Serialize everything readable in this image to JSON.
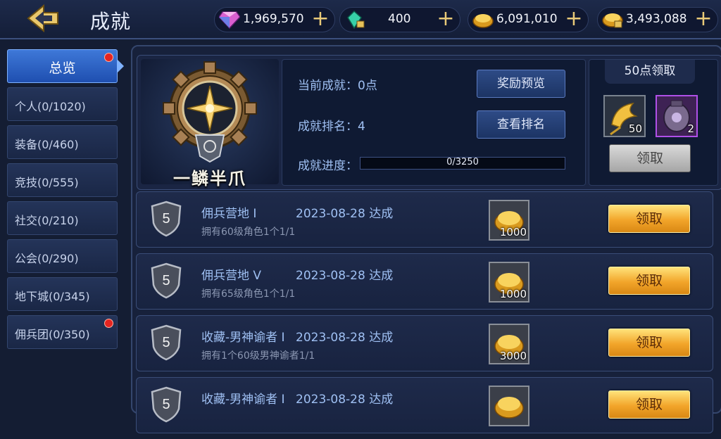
{
  "header": {
    "title": "成就",
    "currencies": [
      {
        "icon": "diamond-icon",
        "value": "1,969,570"
      },
      {
        "icon": "bound-crystal-icon",
        "value": "400"
      },
      {
        "icon": "gold-icon",
        "value": "6,091,010"
      },
      {
        "icon": "bound-gold-icon",
        "value": "3,493,088"
      }
    ]
  },
  "sidebar": {
    "tabs": [
      {
        "label": "总览",
        "active": true,
        "badge": true
      },
      {
        "label": "个人(0/1020)"
      },
      {
        "label": "装备(0/460)"
      },
      {
        "label": "竞技(0/555)"
      },
      {
        "label": "社交(0/210)"
      },
      {
        "label": "公会(0/290)"
      },
      {
        "label": "地下城(0/345)"
      },
      {
        "label": "佣兵团(0/350)",
        "badge": true
      }
    ]
  },
  "summary": {
    "title_name": "一鳞半爪",
    "current_label": "当前成就：0点",
    "rank_label": "成就排名：4",
    "progress_label": "成就进度：",
    "progress_text": "0/3250",
    "progress_value": 0,
    "preview_button": "奖励预览",
    "rank_button": "查看排名"
  },
  "milestone": {
    "title": "50点领取",
    "items": [
      {
        "icon": "ginkgo-leaf-icon",
        "count": "50"
      },
      {
        "icon": "purple-urn-icon",
        "count": "2"
      }
    ],
    "button": "领取"
  },
  "achievements": [
    {
      "level": "5",
      "name": "佣兵营地 I",
      "date": "2023-08-28 达成",
      "desc": "拥有60级角色1个1/1",
      "reward_count": "1000",
      "button": "领取"
    },
    {
      "level": "5",
      "name": "佣兵营地 V",
      "date": "2023-08-28 达成",
      "desc": "拥有65级角色1个1/1",
      "reward_count": "1000",
      "button": "领取"
    },
    {
      "level": "5",
      "name": "收藏-男神谕者 I",
      "date": "2023-08-28 达成",
      "desc": "拥有1个60级男神谕者1/1",
      "reward_count": "3000",
      "button": "领取"
    },
    {
      "level": "5",
      "name": "收藏-男神谕者 I",
      "date": "2023-08-28 达成",
      "desc": "",
      "reward_count": "",
      "button": "领取"
    }
  ],
  "colors": {
    "accent_blue": "#9fc0f3",
    "gold_button": "#f2a52a",
    "active_tab": "#3e78d8",
    "badge_red": "#e52420"
  }
}
